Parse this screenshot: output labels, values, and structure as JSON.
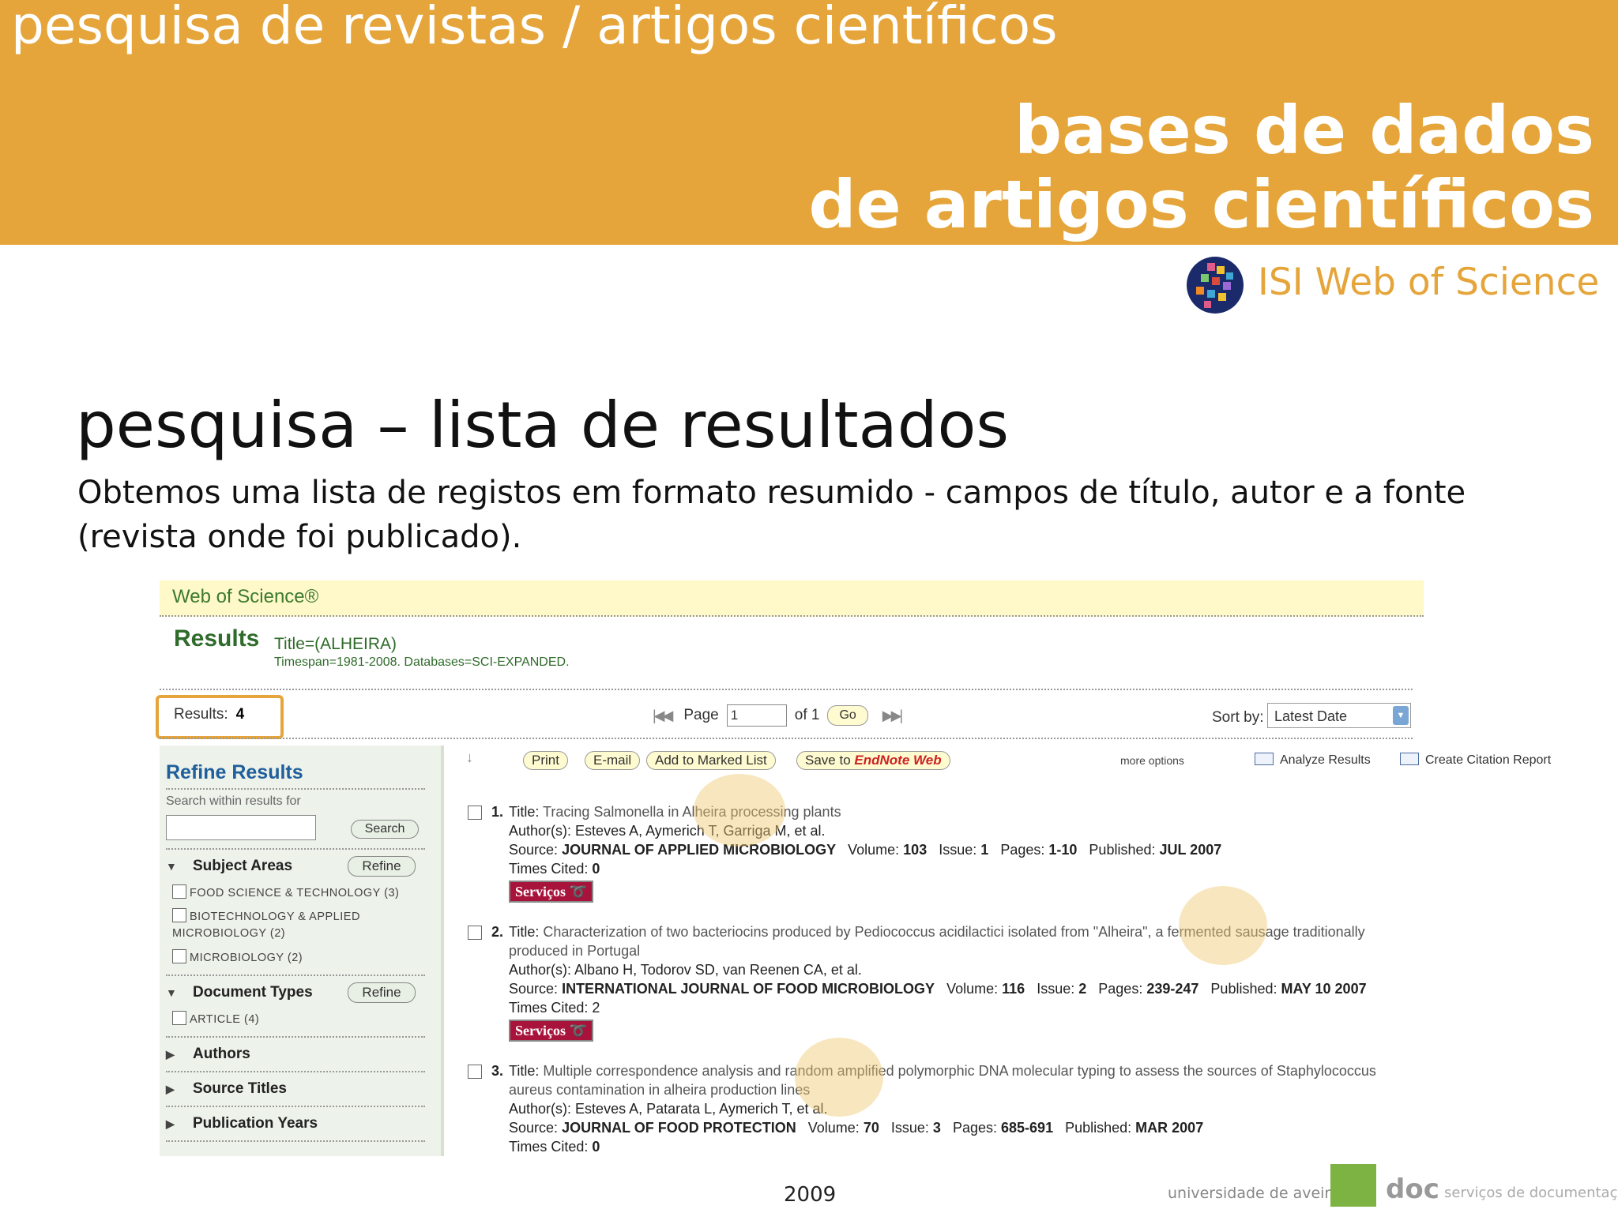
{
  "slide": {
    "banner_top": "pesquisa de revistas / artigos científicos",
    "banner_title_line1": "bases de dados",
    "banner_title_line2": "de artigos científicos",
    "isi_label": "ISI Web of Science",
    "title": "pesquisa – lista de resultados",
    "body": "Obtemos uma lista de registos em formato resumido - campos de título, autor e a fonte (revista onde foi publicado).",
    "year": "2009",
    "footer_university": "universidade de aveiro",
    "footer_doc": "doc",
    "footer_doc_sub": "serviços de documentação"
  },
  "wos": {
    "logo": "Web of Science®",
    "results_title": "Results",
    "query": "Title=(ALHEIRA)",
    "timespan": "Timespan=1981-2008. Databases=SCI-EXPANDED.",
    "results_label": "Results:",
    "results_count": "4",
    "page_label": "Page",
    "page_value": "1",
    "of_label": "of 1",
    "go_label": "Go",
    "sort_label": "Sort by:",
    "sort_value": "Latest Date",
    "toolbar": {
      "print": "Print",
      "email": "E-mail",
      "add_marked": "Add to Marked List",
      "save_to": "Save to",
      "endnote": "EndNote Web",
      "more_options": "more options",
      "analyze": "Analyze Results",
      "citation_report": "Create Citation Report"
    },
    "sidebar": {
      "title": "Refine Results",
      "search_label": "Search within results for",
      "search_button": "Search",
      "subject_areas": "Subject Areas",
      "refine": "Refine",
      "subject_items": [
        "FOOD SCIENCE & TECHNOLOGY (3)",
        "BIOTECHNOLOGY & APPLIED MICROBIOLOGY (2)",
        "MICROBIOLOGY (2)"
      ],
      "document_types": "Document Types",
      "doc_items": [
        "ARTICLE (4)"
      ],
      "authors": "Authors",
      "source_titles": "Source Titles",
      "publication_years": "Publication Years"
    },
    "records": [
      {
        "num": "1.",
        "title": "Tracing Salmonella in Alheira processing plants",
        "authors": "Esteves A, Aymerich T, Garriga M, et al.",
        "source": "JOURNAL OF APPLIED MICROBIOLOGY",
        "volume": "103",
        "issue": "1",
        "pages": "1-10",
        "published": "JUL 2007",
        "times_cited": "0"
      },
      {
        "num": "2.",
        "title": "Characterization of two bacteriocins produced by Pediococcus acidilactici isolated from \"Alheira\", a fermented sausage traditionally produced in Portugal",
        "authors": "Albano H, Todorov SD, van Reenen CA, et al.",
        "source": "INTERNATIONAL JOURNAL OF FOOD MICROBIOLOGY",
        "volume": "116",
        "issue": "2",
        "pages": "239-247",
        "published": "MAY 10 2007",
        "times_cited": "2"
      },
      {
        "num": "3.",
        "title": "Multiple correspondence analysis and random amplified polymorphic DNA molecular typing to assess the sources of Staphylococcus aureus contamination in alheira production lines",
        "authors": "Esteves A, Patarata L, Aymerich T, et al.",
        "source": "JOURNAL OF FOOD PROTECTION",
        "volume": "70",
        "issue": "3",
        "pages": "685-691",
        "published": "MAR 2007",
        "times_cited": "0"
      }
    ],
    "labels": {
      "title": "Title:",
      "authors": "Author(s):",
      "source": "Source:",
      "volume": "Volume:",
      "issue": "Issue:",
      "pages": "Pages:",
      "published": "Published:",
      "times_cited": "Times Cited:",
      "servicos": "Serviços"
    }
  }
}
